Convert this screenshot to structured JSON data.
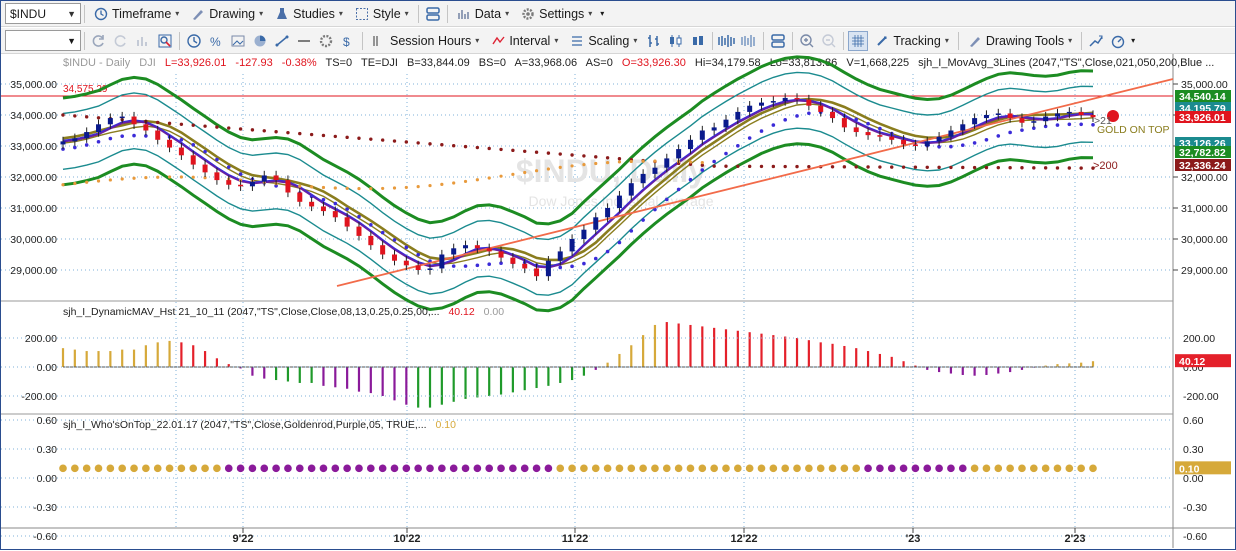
{
  "toolbar1": {
    "symbol": "$INDU",
    "items": [
      {
        "label": "Timeframe",
        "icon": "timeframe-icon"
      },
      {
        "label": "Drawing",
        "icon": "drawing-icon"
      },
      {
        "label": "Studies",
        "icon": "studies-icon"
      },
      {
        "label": "Style",
        "icon": "style-icon"
      },
      {
        "label": "Data",
        "icon": "data-icon"
      },
      {
        "label": "Settings",
        "icon": "settings-icon"
      }
    ]
  },
  "toolbar2": {
    "interval_value": "",
    "session_label": "Session Hours",
    "interval_label": "Interval",
    "scaling_label": "Scaling",
    "tracking_label": "Tracking",
    "drawing_tools_label": "Drawing Tools"
  },
  "header": {
    "name": "$INDU - Daily",
    "exchange": "DJI",
    "last": "L=33,926.01",
    "chg": "-127.93",
    "pct": "-0.38%",
    "ts": "TS=0",
    "te": "TE=DJI",
    "bid": "B=33,844.09",
    "bs": "BS=0",
    "ask": "A=33,968.06",
    "as": "AS=0",
    "open": "O=33,926.30",
    "hi": "Hi=34,179.58",
    "lo": "Lo=33,813.86",
    "vol": "V=1,668,225",
    "study": "sjh_I_MovAvg_3Lines (2047,\"TS\",Close,021,050,200,Blue ..."
  },
  "colors": {
    "up": "#0a1a8c",
    "down": "#e0141e",
    "band": "#1c8c22",
    "teal": "#1b8b8f",
    "ma_blue": "#3b2bd8",
    "ma_purple": "#6c1f9e",
    "ma_olive": "#8a7d1e",
    "dots200": "#8b1a1a",
    "dots_orange": "#e89a3c",
    "trend": "#f26b4a",
    "hist_red": "#e4202a",
    "hist_gold": "#d6a93a",
    "hist_purple": "#8a1a9a",
    "hist_green": "#1f9a2a"
  },
  "main_price": {
    "hline_label": "34,575.29",
    "axis": [
      "35,000.00",
      "34,000.00",
      "33,000.00",
      "32,000.00",
      "31,000.00",
      "30,000.00",
      "29,000.00"
    ],
    "right_labels": [
      {
        "text": "34,540.14",
        "color": "#1c8c22"
      },
      {
        "text": "34,195.79",
        "color": "#1b8b8f"
      },
      {
        "text": "33,926.01",
        "color": "#e0141e"
      },
      {
        "text": "33,126.26",
        "color": "#1b8b8f"
      },
      {
        "text": "32,782.82",
        "color": "#1c8c22"
      },
      {
        "text": "32,336.24",
        "color": "#8b1a1a"
      }
    ],
    "ann_21": ">21",
    "ann_200": ">200",
    "ann_gold": "GOLD ON TOP",
    "watermark_symbol": "$INDU, Daily",
    "watermark_desc": "Dow Jones Industrial Average"
  },
  "panel2": {
    "title": "sjh_I_DynamicMAV_Hst 21_10_11 (2047,\"TS\",Close,Close,08,13,0.25,0.25,00,...",
    "v1": "40.12",
    "v2": "0.00",
    "axis": [
      "200.00",
      "0.00",
      "-200.00"
    ],
    "last_label": "40.12"
  },
  "panel3": {
    "title": "sjh_I_Who'sOnTop_22.01.17 (2047,\"TS\",Close,Goldenrod,Purple,05, TRUE,...",
    "v1": "0.10",
    "axis": [
      "0.60",
      "0.30",
      "0.00",
      "-0.30",
      "-0.60"
    ],
    "last_label": "0.10"
  },
  "xaxis": [
    "9'22",
    "10'22",
    "11'22",
    "12'22",
    "'23",
    "2'23"
  ],
  "chart_data": {
    "type": "candlestick",
    "title": "$INDU - Daily",
    "ylim": [
      28300,
      35600
    ],
    "series_main": [
      33150,
      33250,
      33450,
      33700,
      33900,
      33950,
      33700,
      33500,
      33200,
      32950,
      32700,
      32400,
      32150,
      31900,
      31750,
      31700,
      31850,
      32050,
      31900,
      31500,
      31200,
      31050,
      30900,
      30700,
      30400,
      30100,
      29800,
      29500,
      29300,
      29150,
      29000,
      29050,
      29500,
      29700,
      29800,
      29700,
      29600,
      29400,
      29200,
      29050,
      28800,
      29300,
      29600,
      30000,
      30300,
      30700,
      31000,
      31400,
      31800,
      32100,
      32300,
      32600,
      32900,
      33200,
      33500,
      33600,
      33850,
      34100,
      34300,
      34400,
      34450,
      34550,
      34500,
      34300,
      34100,
      33900,
      33600,
      33450,
      33350,
      33300,
      33200,
      33050,
      33000,
      33150,
      33300,
      33500,
      33700,
      33900,
      34000,
      34050,
      33900,
      33750,
      33800,
      33950,
      34050,
      34100,
      34000,
      33926
    ],
    "hist": [
      130,
      120,
      110,
      110,
      110,
      120,
      120,
      150,
      170,
      180,
      170,
      150,
      110,
      60,
      20,
      -10,
      -60,
      -80,
      -90,
      -100,
      -110,
      -110,
      -130,
      -140,
      -150,
      -170,
      -180,
      -200,
      -230,
      -260,
      -280,
      -280,
      -260,
      -240,
      -220,
      -210,
      -200,
      -190,
      -175,
      -160,
      -145,
      -130,
      -110,
      -90,
      -60,
      -20,
      30,
      90,
      150,
      220,
      290,
      310,
      300,
      290,
      280,
      270,
      260,
      250,
      240,
      230,
      220,
      210,
      200,
      185,
      170,
      160,
      145,
      130,
      110,
      90,
      70,
      40,
      10,
      -20,
      -35,
      -45,
      -55,
      -60,
      -55,
      -45,
      -35,
      -20,
      -5,
      10,
      20,
      25,
      30,
      40
    ],
    "who_on_top": [
      "gold",
      "gold",
      "gold",
      "gold",
      "gold",
      "gold",
      "gold",
      "gold",
      "gold",
      "gold",
      "gold",
      "gold",
      "gold",
      "gold",
      "purple",
      "purple",
      "purple",
      "purple",
      "purple",
      "purple",
      "purple",
      "purple",
      "purple",
      "purple",
      "purple",
      "purple",
      "purple",
      "purple",
      "purple",
      "purple",
      "purple",
      "purple",
      "purple",
      "purple",
      "purple",
      "purple",
      "purple",
      "purple",
      "purple",
      "purple",
      "purple",
      "purple",
      "gold",
      "gold",
      "gold",
      "gold",
      "gold",
      "gold",
      "gold",
      "gold",
      "gold",
      "gold",
      "gold",
      "gold",
      "gold",
      "gold",
      "gold",
      "gold",
      "gold",
      "gold",
      "gold",
      "gold",
      "gold",
      "gold",
      "gold",
      "gold",
      "gold",
      "gold",
      "purple",
      "purple",
      "purple",
      "purple",
      "purple",
      "purple",
      "purple",
      "purple",
      "purple",
      "gold",
      "gold",
      "gold",
      "gold",
      "gold",
      "gold",
      "gold",
      "gold",
      "gold",
      "gold",
      "gold"
    ]
  }
}
